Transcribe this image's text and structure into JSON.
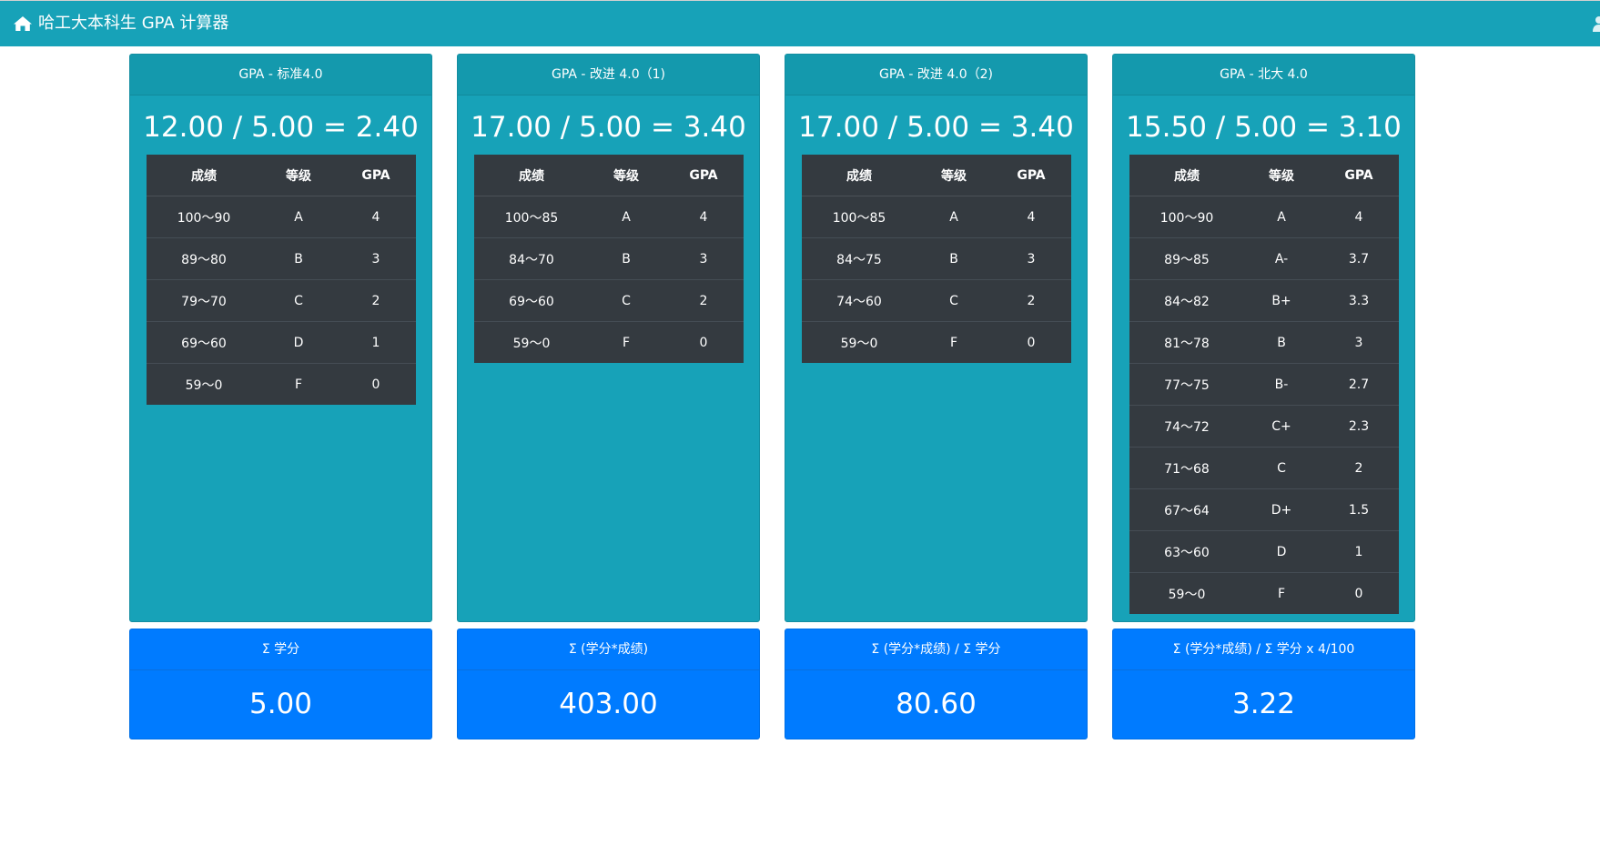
{
  "navbar": {
    "title": "哈工大本科生 GPA 计算器",
    "icon": "home-icon",
    "user_icon": "user-icon"
  },
  "table_headers": [
    "成绩",
    "等级",
    "GPA"
  ],
  "cards": [
    {
      "title": "GPA - 标准4.0",
      "formula": "12.00 / 5.00 = 2.40",
      "rows": [
        [
          "100～90",
          "A",
          "4"
        ],
        [
          "89～80",
          "B",
          "3"
        ],
        [
          "79～70",
          "C",
          "2"
        ],
        [
          "69～60",
          "D",
          "1"
        ],
        [
          "59～0",
          "F",
          "0"
        ]
      ]
    },
    {
      "title": "GPA - 改进 4.0（1)",
      "formula": "17.00 / 5.00 = 3.40",
      "rows": [
        [
          "100～85",
          "A",
          "4"
        ],
        [
          "84～70",
          "B",
          "3"
        ],
        [
          "69～60",
          "C",
          "2"
        ],
        [
          "59～0",
          "F",
          "0"
        ]
      ]
    },
    {
      "title": "GPA - 改进 4.0（2)",
      "formula": "17.00 / 5.00 = 3.40",
      "rows": [
        [
          "100～85",
          "A",
          "4"
        ],
        [
          "84～75",
          "B",
          "3"
        ],
        [
          "74～60",
          "C",
          "2"
        ],
        [
          "59～0",
          "F",
          "0"
        ]
      ]
    },
    {
      "title": "GPA - 北大 4.0",
      "formula": "15.50 / 5.00 = 3.10",
      "rows": [
        [
          "100～90",
          "A",
          "4"
        ],
        [
          "89～85",
          "A-",
          "3.7"
        ],
        [
          "84～82",
          "B+",
          "3.3"
        ],
        [
          "81～78",
          "B",
          "3"
        ],
        [
          "77～75",
          "B-",
          "2.7"
        ],
        [
          "74～72",
          "C+",
          "2.3"
        ],
        [
          "71～68",
          "C",
          "2"
        ],
        [
          "67～64",
          "D+",
          "1.5"
        ],
        [
          "63～60",
          "D",
          "1"
        ],
        [
          "59～0",
          "F",
          "0"
        ]
      ]
    }
  ],
  "stats": [
    {
      "label": "Σ 学分",
      "value": "5.00"
    },
    {
      "label": "Σ (学分*成绩)",
      "value": "403.00"
    },
    {
      "label": "Σ (学分*成绩) / Σ 学分",
      "value": "80.60"
    },
    {
      "label": "Σ (学分*成绩) / Σ 学分 x 4/100",
      "value": "3.22"
    }
  ],
  "colors": {
    "navbar": "#17a2b8",
    "gpa_card": "#17a2b8",
    "table": "#343a40",
    "stat_card": "#007bff"
  }
}
